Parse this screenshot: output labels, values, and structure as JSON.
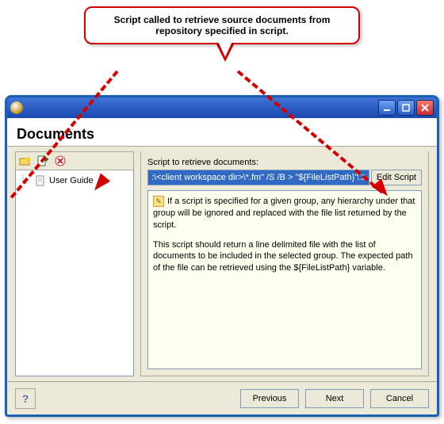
{
  "callout": {
    "text": "Script called to retrieve source documents from repository specified in script."
  },
  "header": {
    "title": "Documents"
  },
  "tree": {
    "items": [
      {
        "label": "User Guide"
      }
    ]
  },
  "right": {
    "field_label": "Script to retrieve documents:",
    "script_value": ":\\<client workspace dir>\\*.fm\" /S /B > \"${FileListPath}\"□□□□",
    "edit_btn": "Edit Script",
    "info_p1": "If a script is specified for a given group, any hierarchy under that group will be ignored and replaced with the file list returned by the script.",
    "info_p2": "This script should return a line delimited file with the list of documents to be included in the selected group.  The expected path of the file can be retrieved using the ${FileListPath} variable."
  },
  "footer": {
    "help": "?",
    "previous": "Previous",
    "next": "Next",
    "cancel": "Cancel"
  },
  "colors": {
    "accent_blue": "#1a5fb4",
    "callout_red": "#d40000",
    "selection_blue": "#316ac5"
  }
}
